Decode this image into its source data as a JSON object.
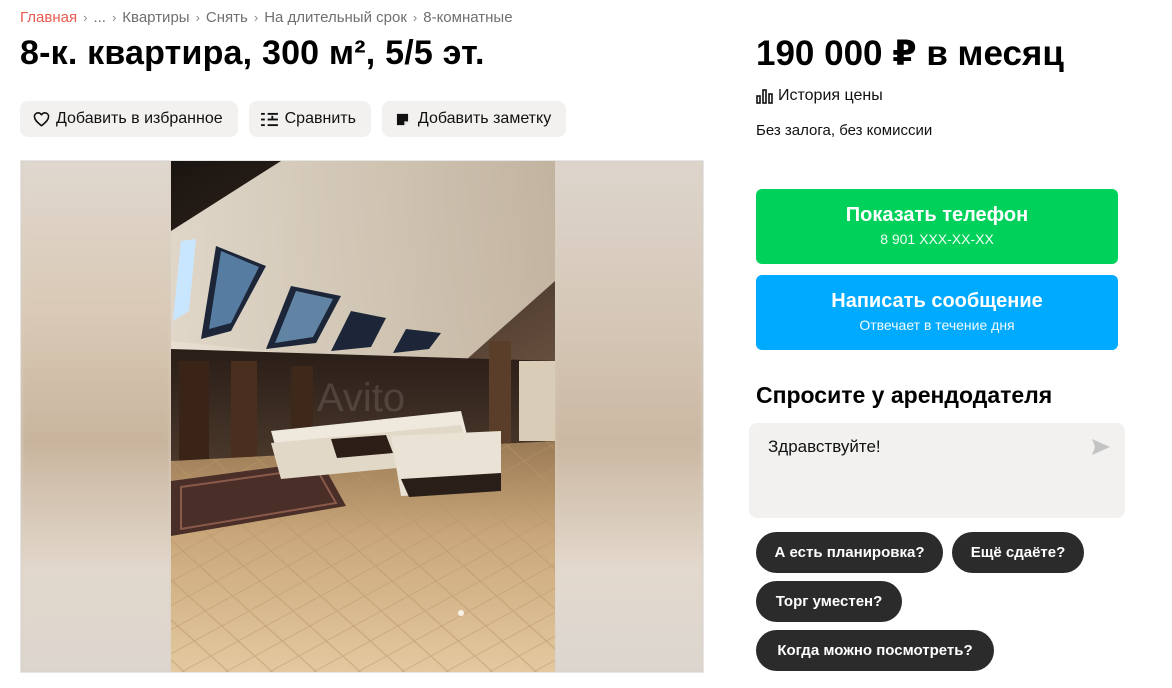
{
  "breadcrumb": {
    "items": [
      "Главная",
      "...",
      "Квартиры",
      "Снять",
      "На длительный срок",
      "8-комнатные"
    ],
    "separator": "›"
  },
  "listing": {
    "title": "8-к. квартира, 300 м², 5/5 эт."
  },
  "actions": {
    "favorite_label": "Добавить в избранное",
    "compare_label": "Сравнить",
    "note_label": "Добавить заметку"
  },
  "gallery": {
    "watermark": "Avito"
  },
  "sidebar": {
    "price": "190 000 ₽ в месяц",
    "price_history_label": "История цены",
    "terms": "Без залога, без комиссии",
    "phone_button": {
      "label": "Показать телефон",
      "number": "8 901 XXX-XX-XX"
    },
    "message_button": {
      "label": "Написать сообщение",
      "sub": "Отвечает в течение дня"
    },
    "ask": {
      "title": "Спросите у арендодателя",
      "message_value": "Здравствуйте!",
      "chips": [
        "А есть планировка?",
        "Ещё сдаёте?",
        "Торг уместен?",
        "Когда можно посмотреть?"
      ]
    }
  },
  "colors": {
    "breadcrumb_first": "#e95a4f",
    "phone_button": "#00d15a",
    "message_button": "#00aaff",
    "chip_bg": "#2b2b2b",
    "action_bg": "#f2f1f0"
  }
}
